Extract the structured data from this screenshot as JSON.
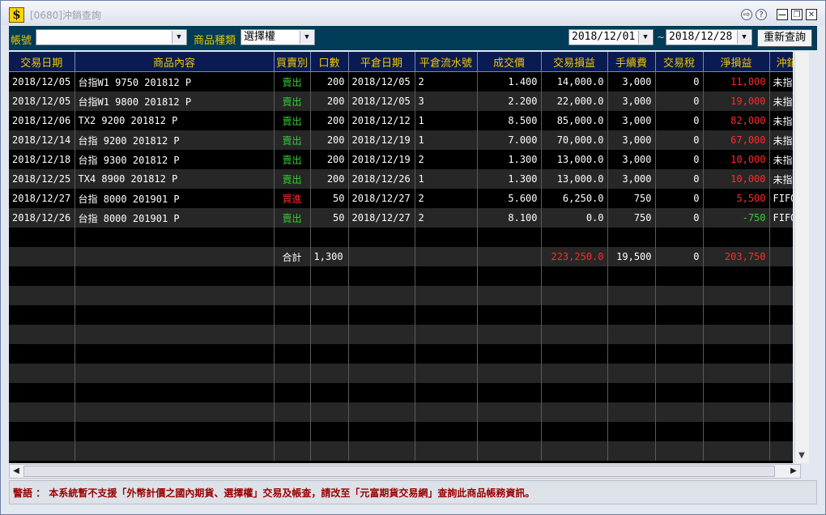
{
  "window": {
    "title": "[0680]沖銷查詢",
    "buttons": {
      "pin": "⇨",
      "help": "?",
      "minimize": "—",
      "restore": "❐",
      "close": "✕"
    }
  },
  "toolbar": {
    "account_label": "帳號",
    "account_value": "",
    "product_type_label": "商品種類",
    "product_type_value": "選擇權",
    "date_from": "2018/12/01",
    "date_sep": "~",
    "date_to": "2018/12/28",
    "requery_label": "重新查詢"
  },
  "table": {
    "columns": [
      "交易日期",
      "商品內容",
      "買賣別",
      "口數",
      "平倉日期",
      "平倉流水號",
      "成交價",
      "交易損益",
      "手續費",
      "交易稅",
      "淨損益",
      "沖銷類"
    ],
    "rows": [
      {
        "trade_date": "2018/12/05",
        "product": "台指W1  9750 201812 P",
        "side": "賣出",
        "qty": "200",
        "close_date": "2018/12/05",
        "close_seq": "2",
        "price": "1.400",
        "trade_pl": "14,000.0",
        "fee": "3,000",
        "tax": "0",
        "net_pl": "11,000",
        "offset_type": "未指"
      },
      {
        "trade_date": "2018/12/05",
        "product": "台指W1  9800 201812 P",
        "side": "賣出",
        "qty": "200",
        "close_date": "2018/12/05",
        "close_seq": "3",
        "price": "2.200",
        "trade_pl": "22,000.0",
        "fee": "3,000",
        "tax": "0",
        "net_pl": "19,000",
        "offset_type": "未指"
      },
      {
        "trade_date": "2018/12/06",
        "product": "TX2   9200 201812 P",
        "side": "賣出",
        "qty": "200",
        "close_date": "2018/12/12",
        "close_seq": "1",
        "price": "8.500",
        "trade_pl": "85,000.0",
        "fee": "3,000",
        "tax": "0",
        "net_pl": "82,000",
        "offset_type": "未指"
      },
      {
        "trade_date": "2018/12/14",
        "product": "台指  9200 201812 P",
        "side": "賣出",
        "qty": "200",
        "close_date": "2018/12/19",
        "close_seq": "1",
        "price": "7.000",
        "trade_pl": "70,000.0",
        "fee": "3,000",
        "tax": "0",
        "net_pl": "67,000",
        "offset_type": "未指"
      },
      {
        "trade_date": "2018/12/18",
        "product": "台指  9300 201812 P",
        "side": "賣出",
        "qty": "200",
        "close_date": "2018/12/19",
        "close_seq": "2",
        "price": "1.300",
        "trade_pl": "13,000.0",
        "fee": "3,000",
        "tax": "0",
        "net_pl": "10,000",
        "offset_type": "未指"
      },
      {
        "trade_date": "2018/12/25",
        "product": "TX4   8900 201812 P",
        "side": "賣出",
        "qty": "200",
        "close_date": "2018/12/26",
        "close_seq": "1",
        "price": "1.300",
        "trade_pl": "13,000.0",
        "fee": "3,000",
        "tax": "0",
        "net_pl": "10,000",
        "offset_type": "未指"
      },
      {
        "trade_date": "2018/12/27",
        "product": "台指  8000 201901 P",
        "side": "買進",
        "qty": "50",
        "close_date": "2018/12/27",
        "close_seq": "2",
        "price": "5.600",
        "trade_pl": "6,250.0",
        "fee": "750",
        "tax": "0",
        "net_pl": "5,500",
        "offset_type": "FIFO"
      },
      {
        "trade_date": "2018/12/26",
        "product": "台指  8000 201901 P",
        "side": "賣出",
        "qty": "50",
        "close_date": "2018/12/27",
        "close_seq": "2",
        "price": "8.100",
        "trade_pl": "0.0",
        "fee": "750",
        "tax": "0",
        "net_pl": "-750",
        "offset_type": "FIFO"
      }
    ],
    "total": {
      "label": "合計",
      "qty": "1,300",
      "trade_pl": "223,250.0",
      "fee": "19,500",
      "tax": "0",
      "net_pl": "203,750"
    }
  },
  "warning": "警語 ： 本系統暫不支援「外幣計價之國內期貨、選擇權」交易及帳查，請改至「元富期貨交易網」查詢此商品帳務資訊。",
  "colors": {
    "header_bg": "#0a1a52",
    "header_text": "#f0c800",
    "toolbar_bg": "#003b57",
    "profit": "#ff2a2a",
    "loss": "#30d030"
  }
}
